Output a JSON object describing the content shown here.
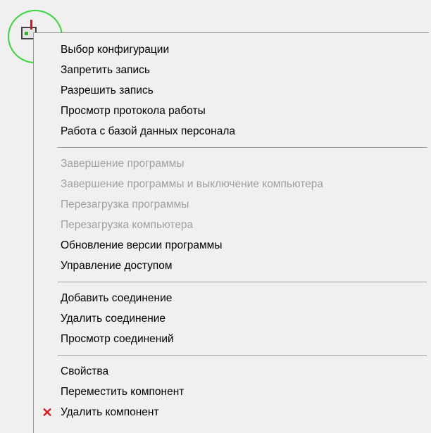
{
  "icon": {
    "name": "component-icon",
    "highlight_color": "#3ad63a"
  },
  "menu": {
    "groups": [
      {
        "items": [
          {
            "label": "Выбор конфигурации",
            "enabled": true
          },
          {
            "label": "Запретить запись",
            "enabled": true
          },
          {
            "label": "Разрешить запись",
            "enabled": true
          },
          {
            "label": "Просмотр протокола работы",
            "enabled": true
          },
          {
            "label": "Работа с базой данных персонала",
            "enabled": true
          }
        ]
      },
      {
        "items": [
          {
            "label": "Завершение программы",
            "enabled": false
          },
          {
            "label": "Завершение программы и выключение компьютера",
            "enabled": false
          },
          {
            "label": "Перезагрузка программы",
            "enabled": false
          },
          {
            "label": "Перезагрузка компьютера",
            "enabled": false
          },
          {
            "label": "Обновление версии программы",
            "enabled": true
          },
          {
            "label": "Управление доступом",
            "enabled": true
          }
        ]
      },
      {
        "items": [
          {
            "label": "Добавить соединение",
            "enabled": true
          },
          {
            "label": "Удалить соединение",
            "enabled": true
          },
          {
            "label": "Просмотр соединений",
            "enabled": true
          }
        ]
      },
      {
        "items": [
          {
            "label": "Свойства",
            "enabled": true
          },
          {
            "label": "Переместить компонент",
            "enabled": true
          },
          {
            "label": "Удалить компонент",
            "enabled": true,
            "icon": "delete-x-icon",
            "icon_glyph": "✕",
            "icon_color": "#e11818"
          }
        ]
      }
    ]
  }
}
